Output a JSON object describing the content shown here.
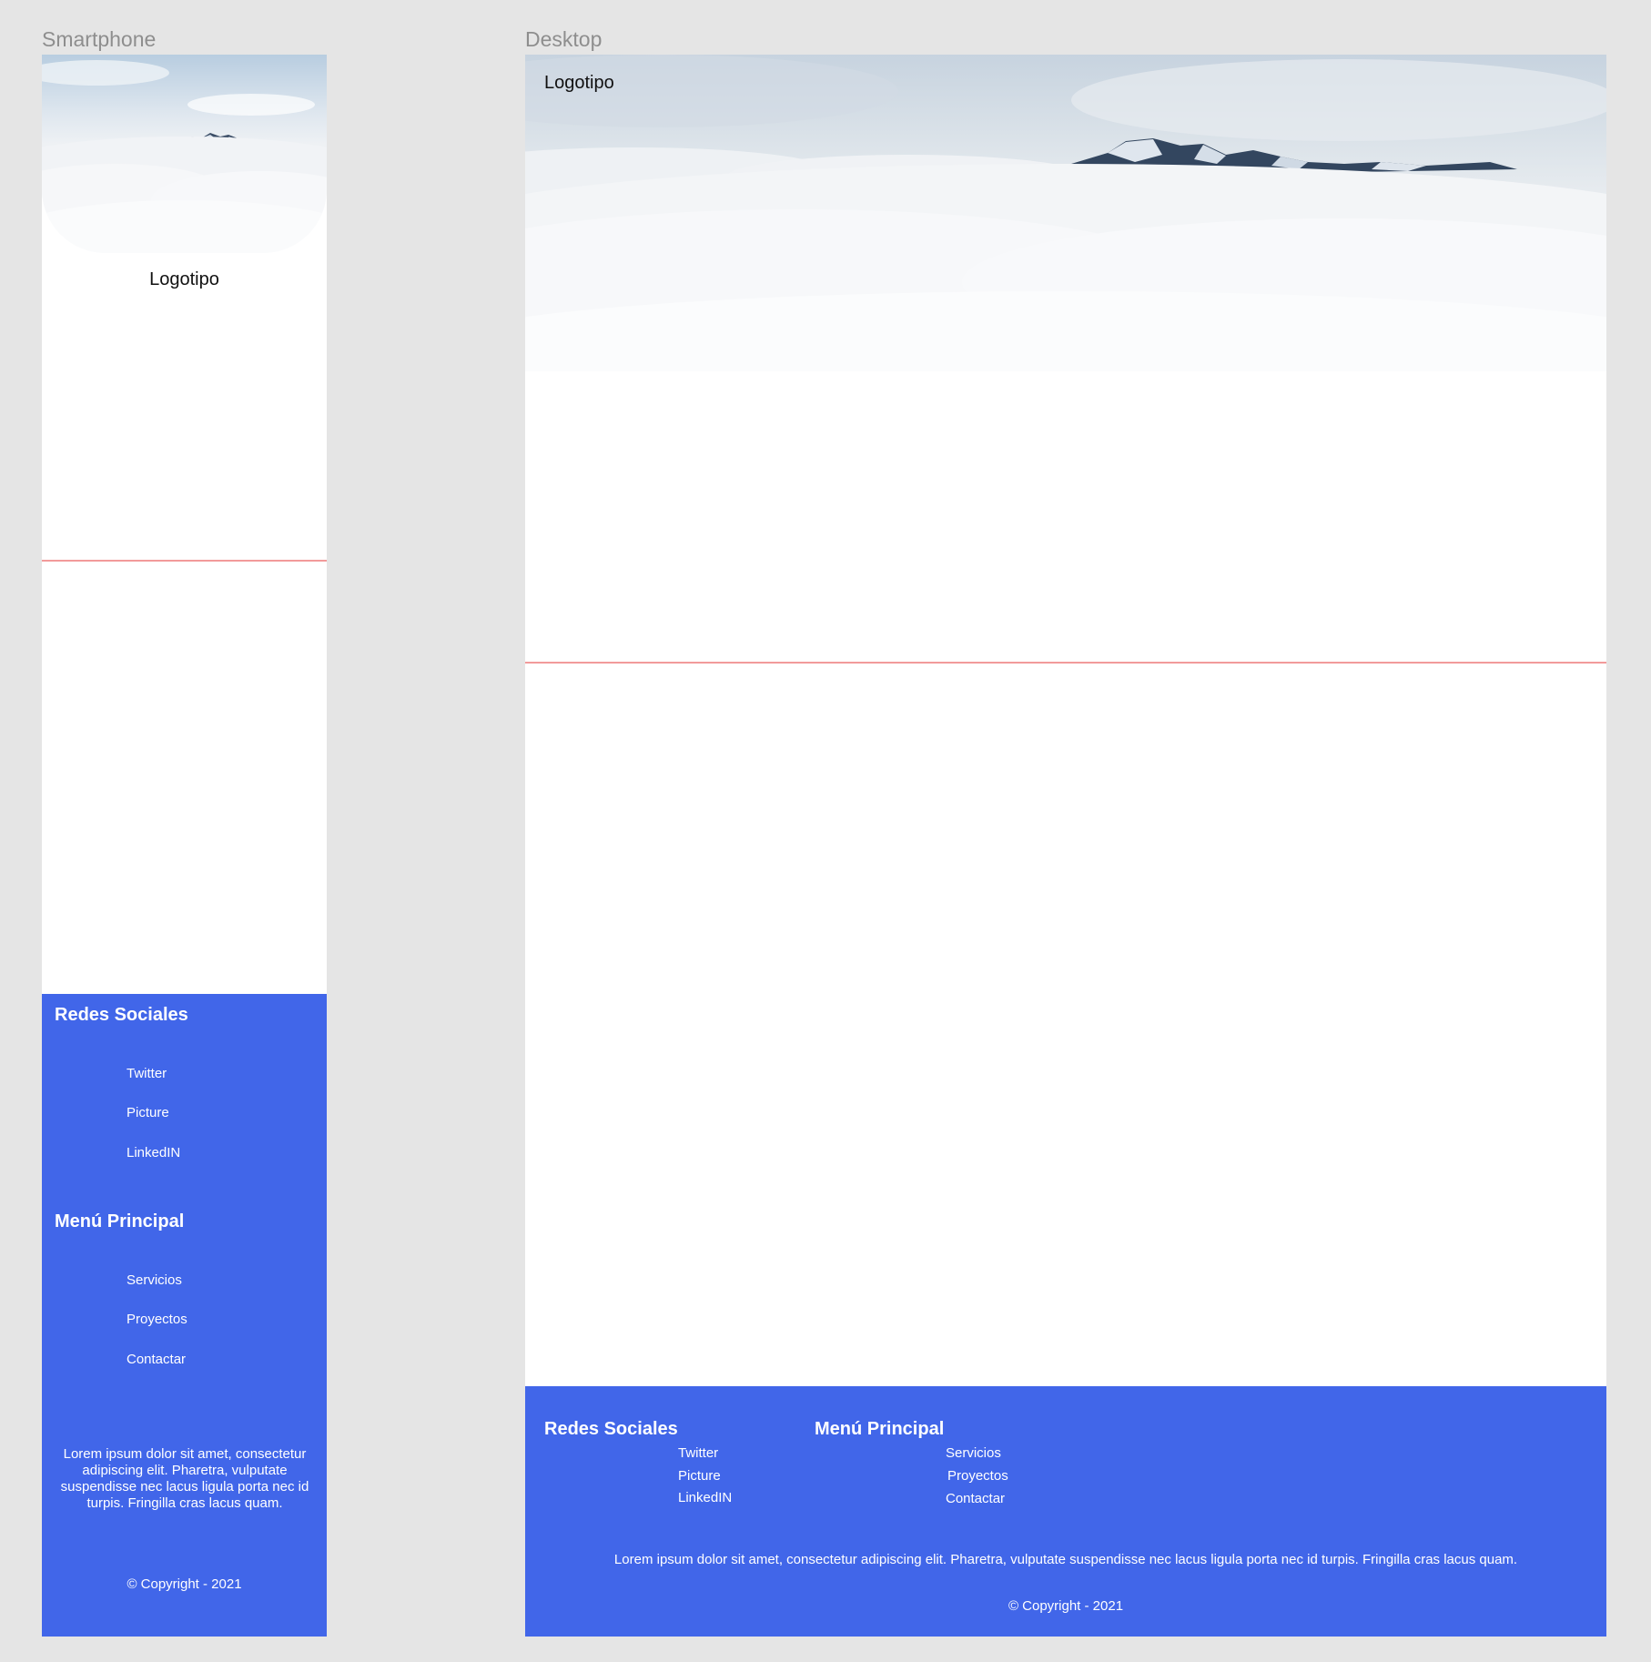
{
  "frames": {
    "smartphone_label": "Smartphone",
    "desktop_label": "Desktop"
  },
  "colors": {
    "canvas": "#e5e5e5",
    "footer": "#4166e9",
    "divider": "#f29a9a"
  },
  "hero_image": {
    "icon": "mountain-clouds-image"
  },
  "logo": "Logotipo",
  "footer": {
    "social_title": "Redes Sociales",
    "social_links": [
      "Twitter",
      "Picture",
      "LinkedIN"
    ],
    "menu_title": "Menú Principal",
    "menu_links": [
      "Servicios",
      "Proyectos",
      "Contactar"
    ],
    "lorem": "Lorem ipsum dolor sit amet, consectetur adipiscing elit. Pharetra, vulputate suspendisse nec lacus ligula porta nec id turpis. Fringilla cras lacus quam.",
    "copyright": "© Copyright - 2021"
  }
}
